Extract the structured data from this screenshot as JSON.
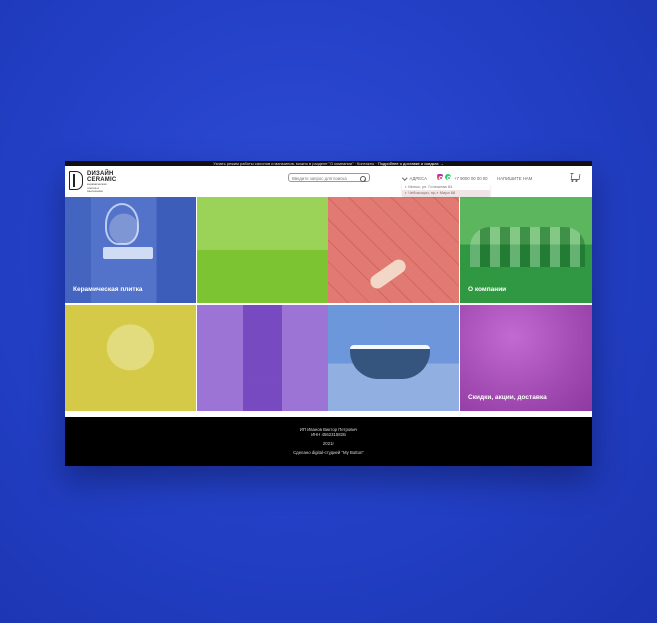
{
  "topbar": {
    "text": "Узнать режим работы салонов и магазинов, можно в разделе \"О компании\" · Контакты ·",
    "link": "Подробнее о доставке и скидках →"
  },
  "header": {
    "logo": {
      "line1": "DИЗАЙН",
      "line2": "CERAMIC",
      "tagline": "керамическая плитка и сантехника"
    },
    "search": {
      "placeholder": "Введите запрос для поиска"
    },
    "addresses_toggle": "АДРЕСА",
    "addresses": [
      "г. Минск, ул. Голешева 84",
      "г. Чебоксары, пр-т Мира 68"
    ],
    "phone": "+7 9000 00 00 00",
    "write_label": "НАПИШИТЕ НАМ",
    "icons": [
      "chevron-down-icon",
      "instagram-icon",
      "whatsapp-icon",
      "cart-icon"
    ]
  },
  "tiles": [
    {
      "label": "Керамическая плитка",
      "color": "#4a6cc4"
    },
    {
      "label": "",
      "color": "#8cc63f"
    },
    {
      "label": "",
      "color": "#e0706a"
    },
    {
      "label": "О компании",
      "color": "#3fae54"
    },
    {
      "label": "",
      "color": "#d4c64a"
    },
    {
      "label": "",
      "color": "#8c5ad0"
    },
    {
      "label": "",
      "color": "#4d7fd4"
    },
    {
      "label": "Скидки, акции, доставка",
      "color": "#b050c0"
    }
  ],
  "footer": {
    "company": "ИП Иванов Виктор Петрович",
    "inn": "ИНН 456231582Б",
    "year": "2021г",
    "credit": "Сделано digital-студией \"My Button\""
  },
  "colors": {
    "background": "#2441c8",
    "footer": "#000000"
  }
}
